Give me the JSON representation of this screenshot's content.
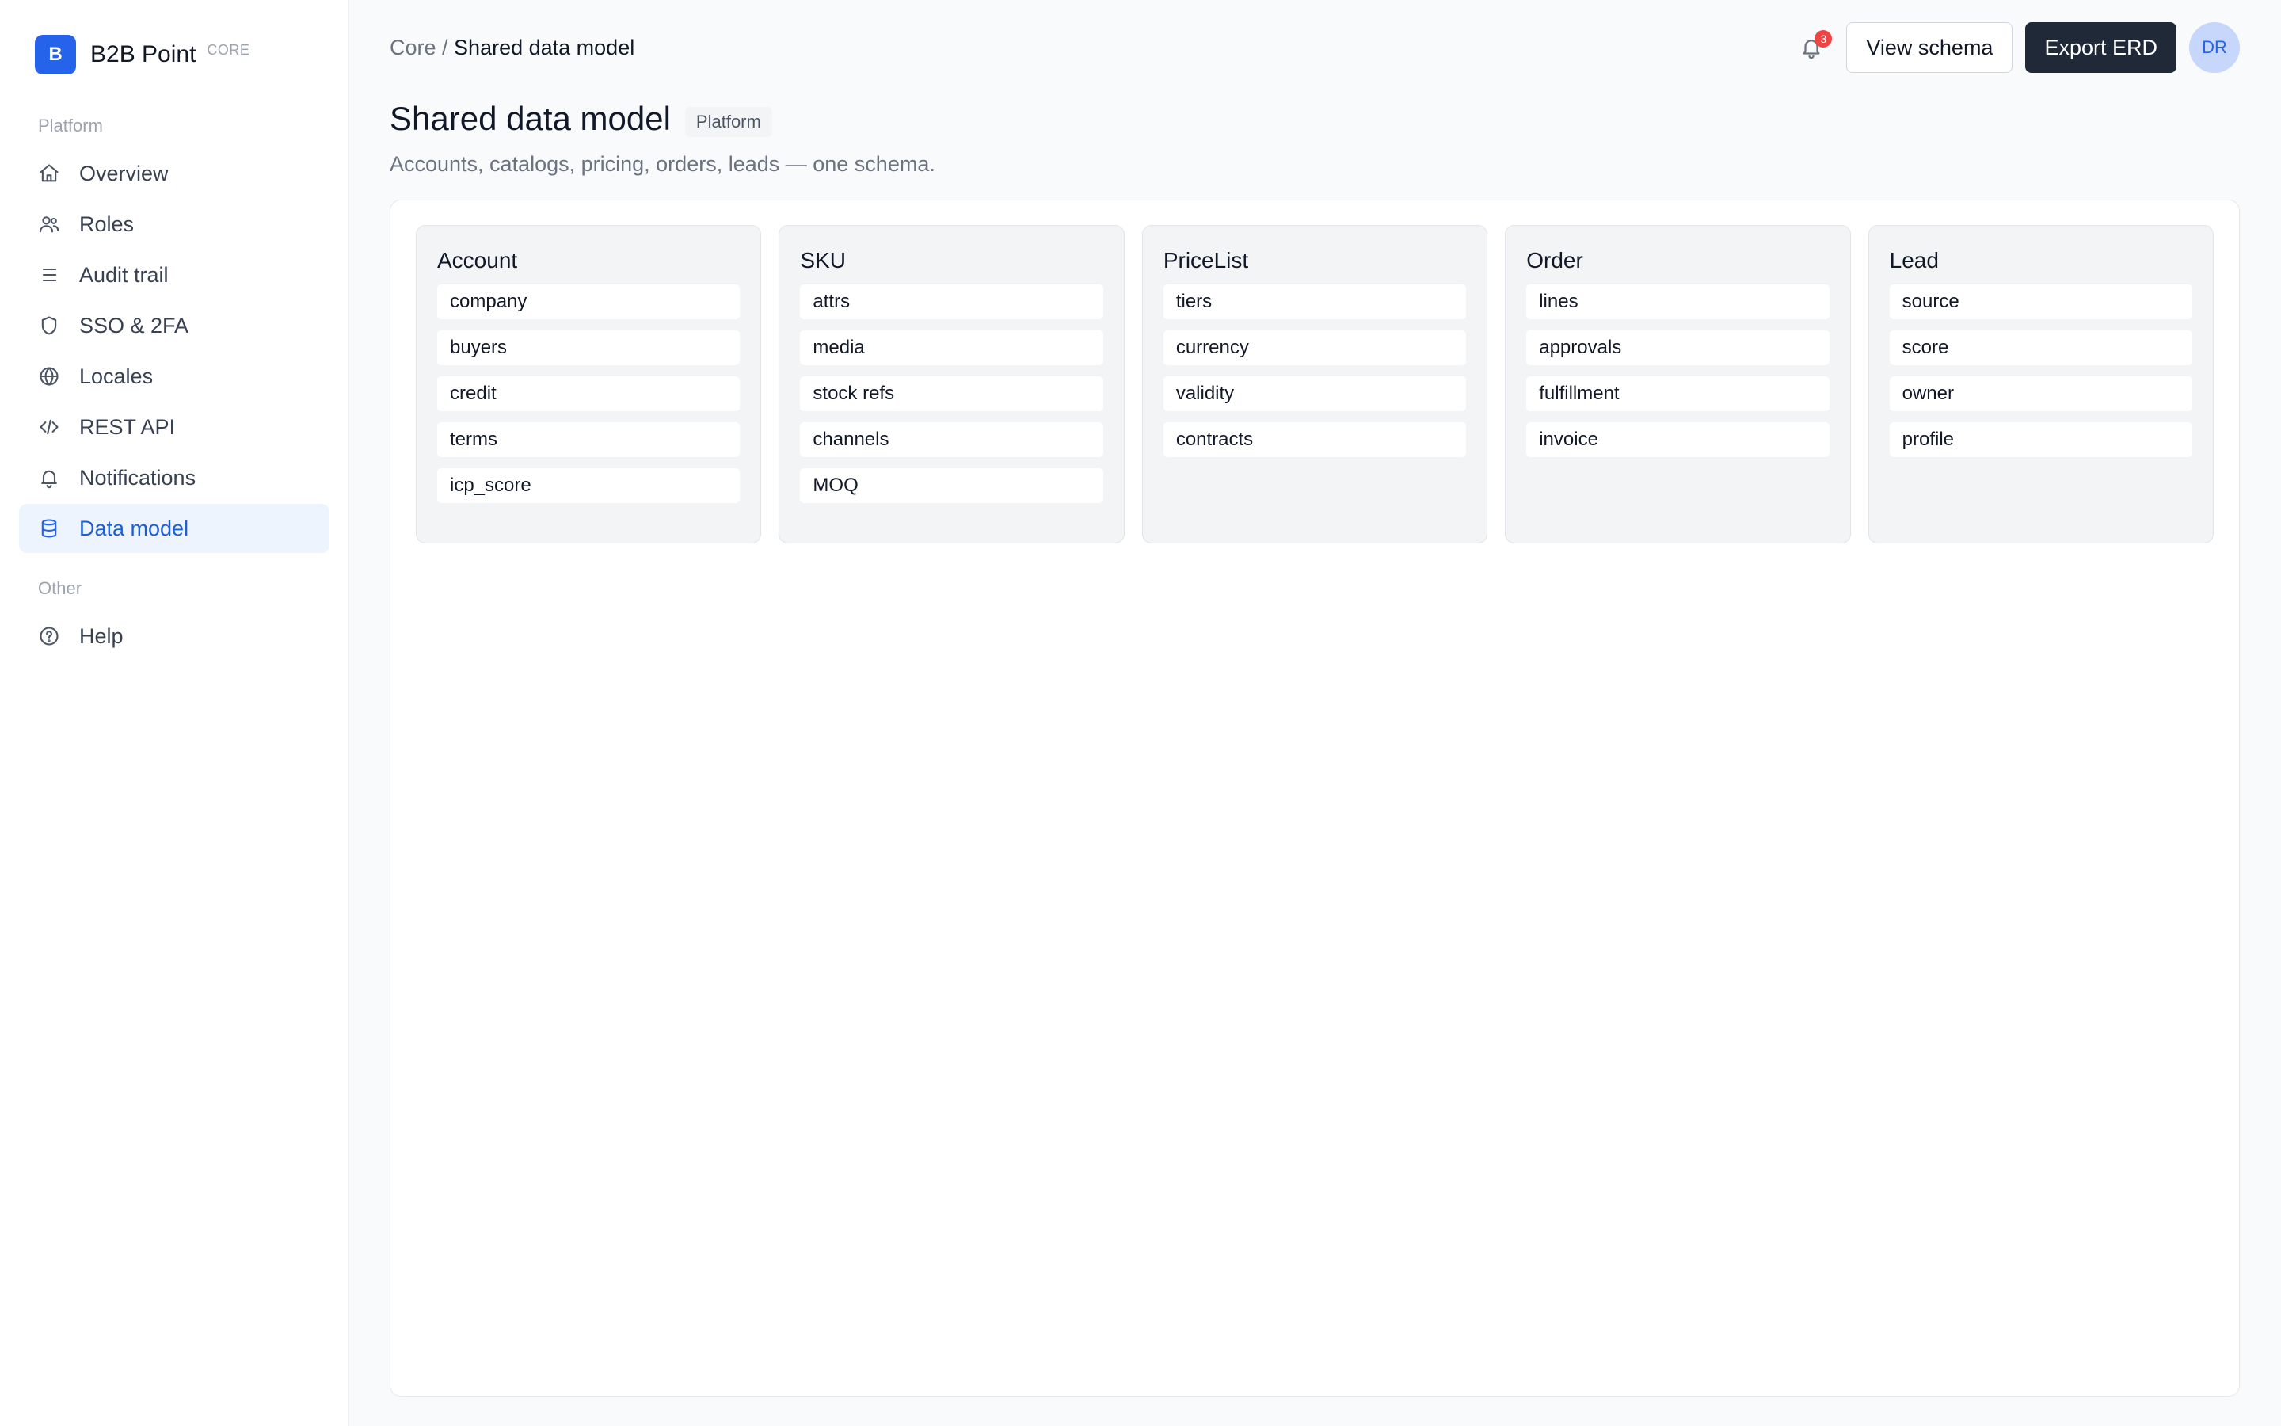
{
  "brand": {
    "logo_letter": "B",
    "name": "B2B Point",
    "tag": "CORE",
    "accent": "#2563eb"
  },
  "sidebar": {
    "sections": [
      {
        "label": "Platform",
        "items": [
          {
            "label": "Overview",
            "icon": "home-icon"
          },
          {
            "label": "Roles",
            "icon": "users-icon"
          },
          {
            "label": "Audit trail",
            "icon": "list-icon"
          },
          {
            "label": "SSO & 2FA",
            "icon": "shield-icon"
          },
          {
            "label": "Locales",
            "icon": "globe-icon"
          },
          {
            "label": "REST API",
            "icon": "code-icon"
          },
          {
            "label": "Notifications",
            "icon": "bell-icon"
          },
          {
            "label": "Data model",
            "icon": "database-icon",
            "active": true
          }
        ]
      },
      {
        "label": "Other",
        "items": [
          {
            "label": "Help",
            "icon": "help-circle-icon"
          }
        ]
      }
    ]
  },
  "header": {
    "breadcrumb": {
      "parent": "Core",
      "separator": " / ",
      "current": "Shared data model"
    },
    "notifications_count": "3",
    "view_schema_label": "View schema",
    "export_label": "Export ERD",
    "avatar_initials": "DR"
  },
  "page": {
    "title": "Shared data model",
    "badge": "Platform",
    "subtitle": "Accounts, catalogs, pricing, orders, leads — one schema."
  },
  "entities": [
    {
      "name": "Account",
      "fields": [
        "company",
        "buyers",
        "credit",
        "terms",
        "icp_score"
      ]
    },
    {
      "name": "SKU",
      "fields": [
        "attrs",
        "media",
        "stock refs",
        "channels",
        "MOQ"
      ]
    },
    {
      "name": "PriceList",
      "fields": [
        "tiers",
        "currency",
        "validity",
        "contracts"
      ]
    },
    {
      "name": "Order",
      "fields": [
        "lines",
        "approvals",
        "fulfillment",
        "invoice"
      ]
    },
    {
      "name": "Lead",
      "fields": [
        "source",
        "score",
        "owner",
        "profile"
      ]
    }
  ]
}
